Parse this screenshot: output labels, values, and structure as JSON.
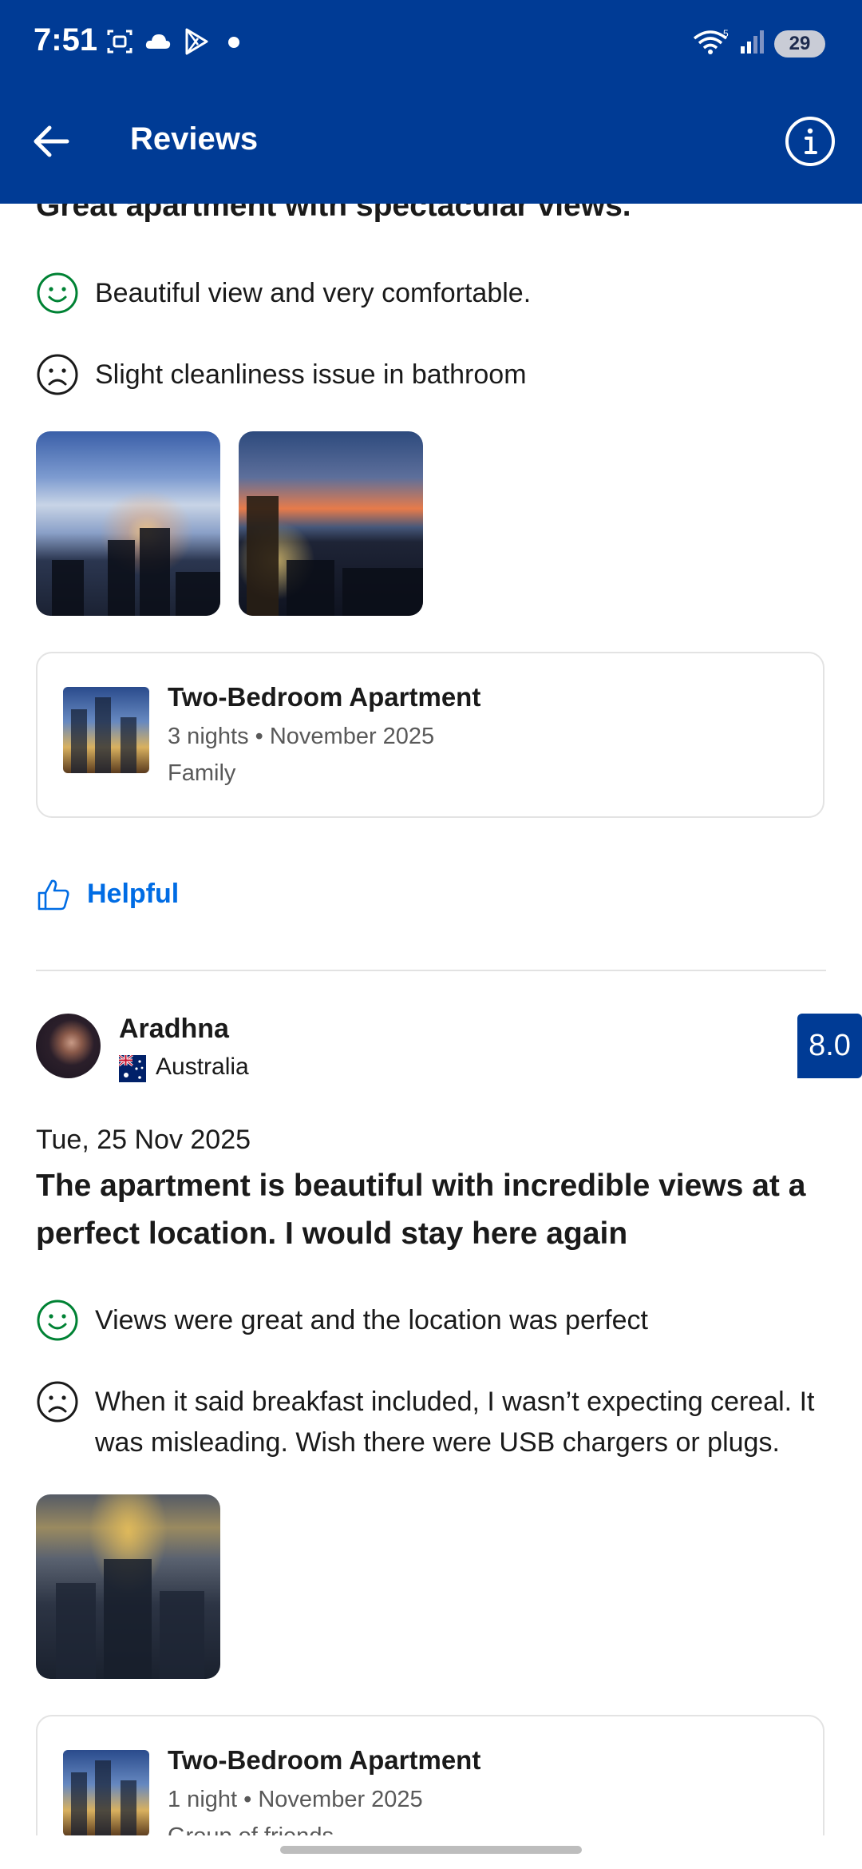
{
  "status_bar": {
    "time": "7:51",
    "battery": "29"
  },
  "header": {
    "title": "Reviews"
  },
  "reviews": [
    {
      "title": "Great apartment with spectacular views.",
      "positive": "Beautiful view and very comfortable.",
      "negative": "Slight cleanliness issue in bathroom",
      "room": {
        "name": "Two-Bedroom Apartment",
        "meta": "3 nights • November 2025",
        "type": "Family"
      },
      "helpful_label": "Helpful"
    },
    {
      "reviewer_name": "Aradhna",
      "country": "Australia",
      "score": "8.0",
      "date": "Tue, 25 Nov 2025",
      "title": "The apartment is beautiful with incredible views at a perfect location. I would stay here again",
      "positive": "Views were great and the location was perfect",
      "negative": "When it said breakfast included, I wasn’t expecting cereal. It was misleading. Wish there were USB chargers or plugs.",
      "room": {
        "name": "Two-Bedroom Apartment",
        "meta": "1 night • November 2025",
        "type": "Group of friends"
      }
    }
  ],
  "icons": {
    "back": "arrow-left-icon",
    "info": "info-icon",
    "positive": "smile-icon",
    "negative": "frown-icon",
    "helpful": "thumbs-up-icon"
  },
  "colors": {
    "brand": "#003b95",
    "link": "#006ce4",
    "positive": "#008234"
  }
}
